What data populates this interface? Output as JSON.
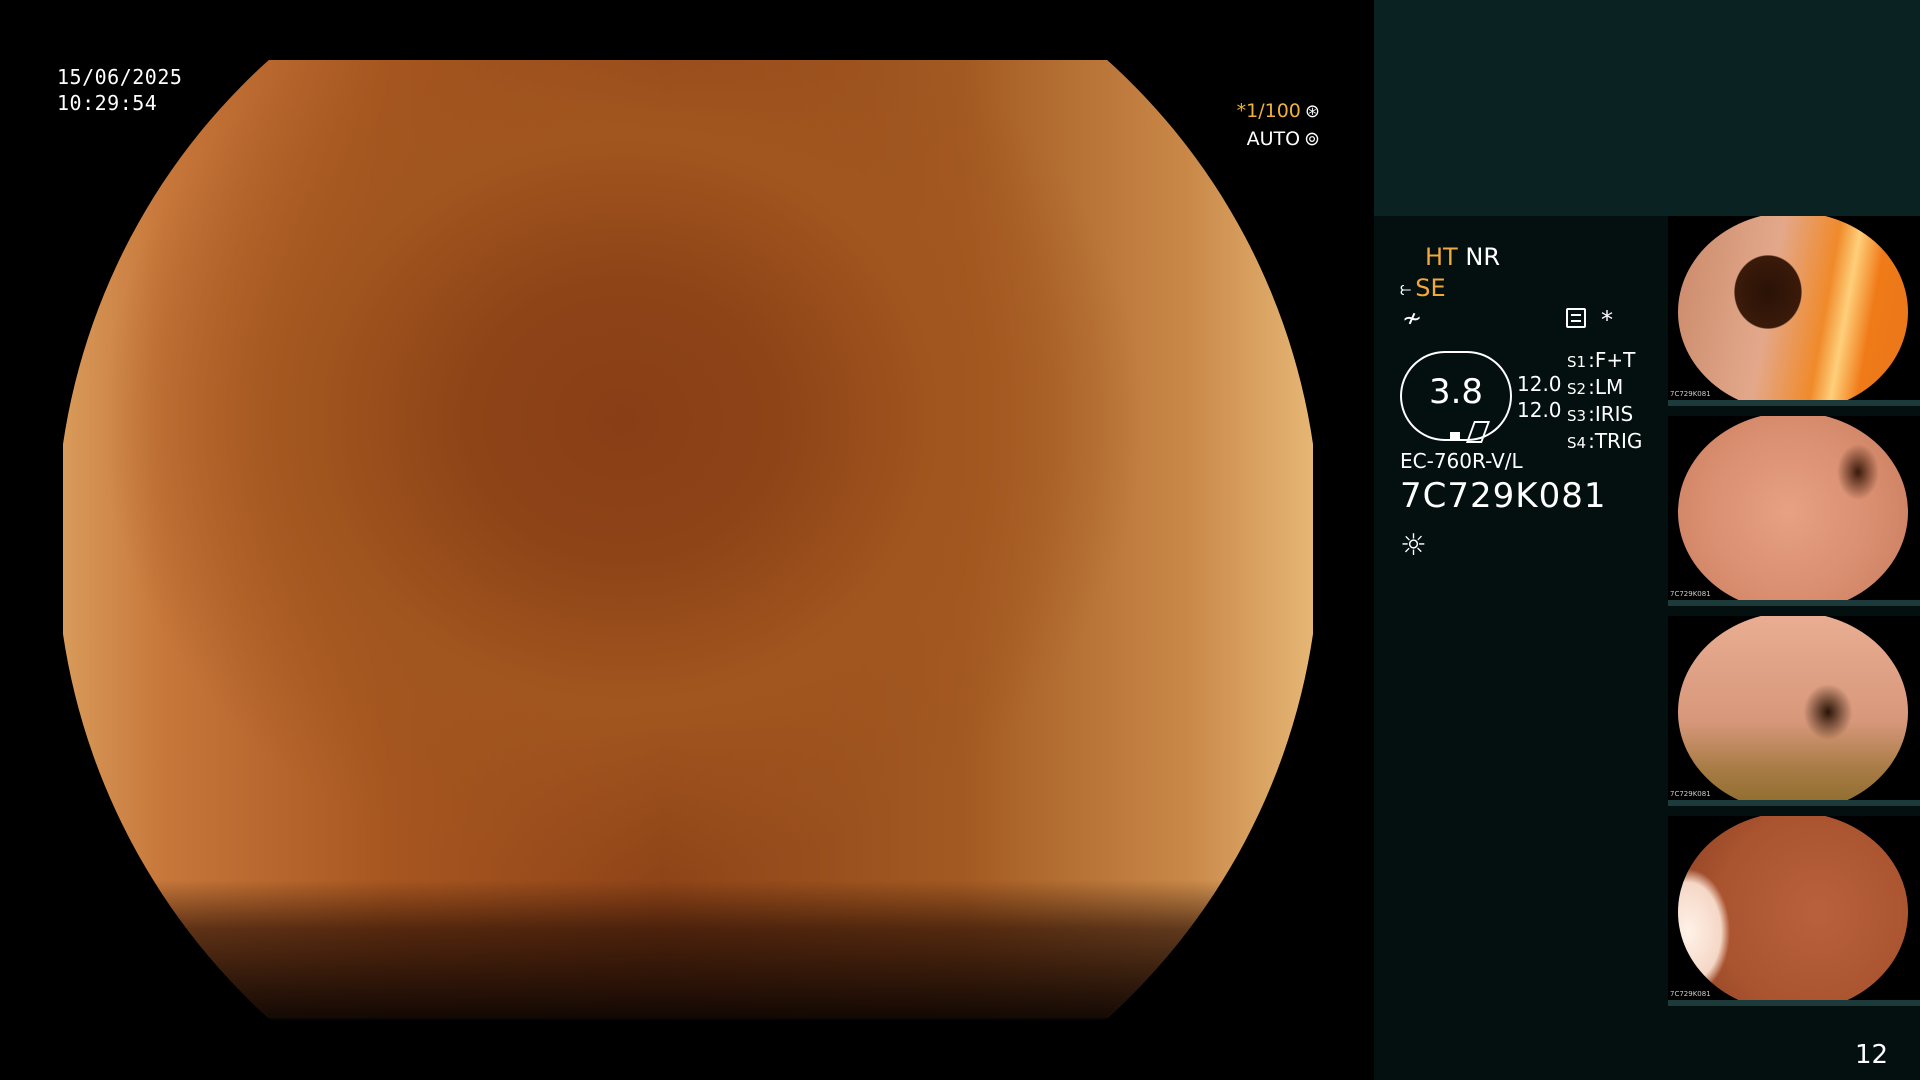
{
  "overlay": {
    "date": "15/06/2025",
    "time": "10:29:54",
    "shutter": "*1/100",
    "shutter_icon": "shutter-icon",
    "iris_mode": "AUTO",
    "iris_icon": "iris-icon"
  },
  "panel": {
    "ht": "HT",
    "nr": "NR",
    "se": "SE",
    "enhance_icon": "enhance-icon",
    "star": "*",
    "zoom": "3.8",
    "zoom_line1": "12.0",
    "zoom_line2": "12.0",
    "switches": [
      {
        "key": "S1",
        "value": "F+T"
      },
      {
        "key": "S2",
        "value": "LM"
      },
      {
        "key": "S3",
        "value": "IRIS"
      },
      {
        "key": "S4",
        "value": "TRIG"
      }
    ],
    "model": "EC-760R-V/L",
    "serial": "7C729K081",
    "light_icon": "light-icon"
  },
  "thumbnails": [
    {
      "caption": "7C729K081"
    },
    {
      "caption": "7C729K081"
    },
    {
      "caption": "7C729K081"
    },
    {
      "caption": "7C729K081"
    }
  ],
  "page_number": "12",
  "colors": {
    "accent": "#f0a93a",
    "panel_bg": "#03100f",
    "panel_top": "#0b2222"
  }
}
